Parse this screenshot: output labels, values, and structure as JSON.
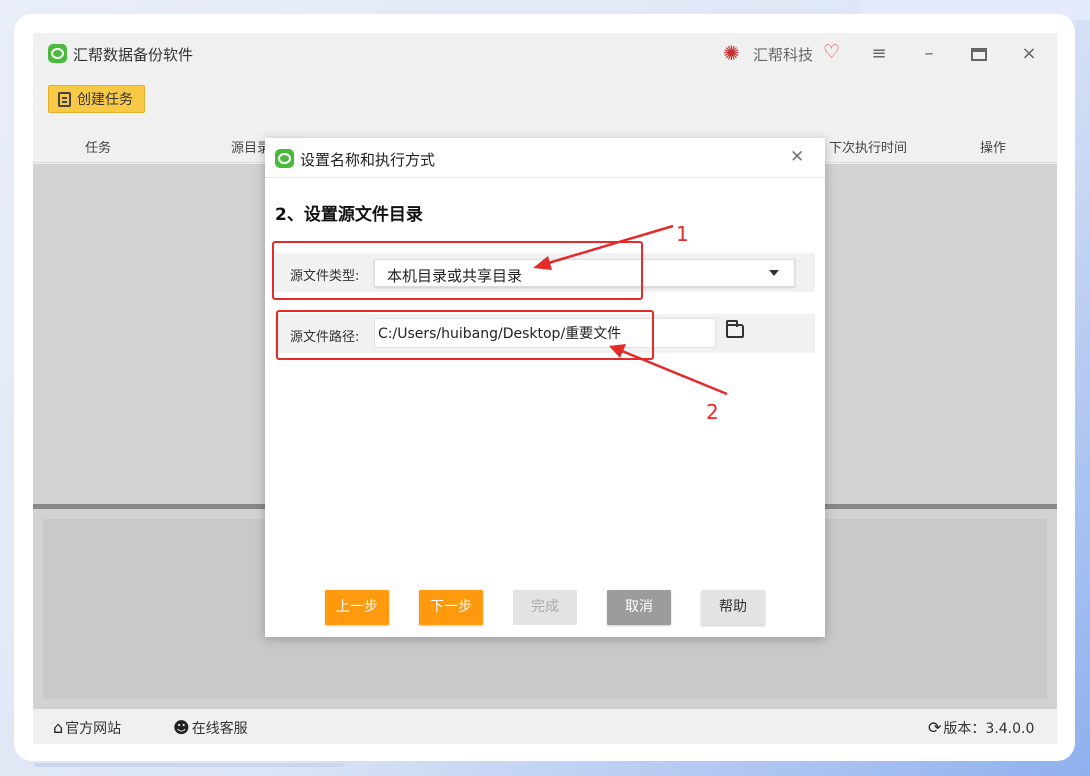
{
  "app": {
    "title": "汇帮数据备份软件",
    "brand_name": "汇帮科技",
    "create_task_label": "创建任务",
    "columns": [
      "任务",
      "源目录",
      "下次执行时间",
      "操作"
    ],
    "status": {
      "website": "官方网站",
      "support": "在线客服",
      "version": "版本：3.4.0.0"
    }
  },
  "dialog": {
    "title": "设置名称和执行方式",
    "step_heading": "2、设置源文件目录",
    "source_type_label": "源文件类型:",
    "source_type_value": "本机目录或共享目录",
    "source_path_label": "源文件路径:",
    "source_path_value": "C:/Users/huibang/Desktop/重要文件",
    "buttons": {
      "prev": "上一步",
      "next": "下一步",
      "finish": "完成",
      "cancel": "取消",
      "help": "帮助"
    }
  },
  "annotations": {
    "label_1": "1",
    "label_2": "2"
  },
  "colors": {
    "accent_orange": "#ff9a0f",
    "annotation_red": "#e52a2a",
    "create_button": "#f7c945",
    "logo_green": "#4aba3b"
  },
  "icons": [
    "app-logo-icon",
    "brand-logo-icon",
    "heart-icon",
    "menu-icon",
    "minimize-icon",
    "maximize-icon",
    "close-icon",
    "document-icon",
    "folder-icon",
    "home-icon",
    "support-icon",
    "refresh-icon",
    "chevron-down-icon"
  ]
}
